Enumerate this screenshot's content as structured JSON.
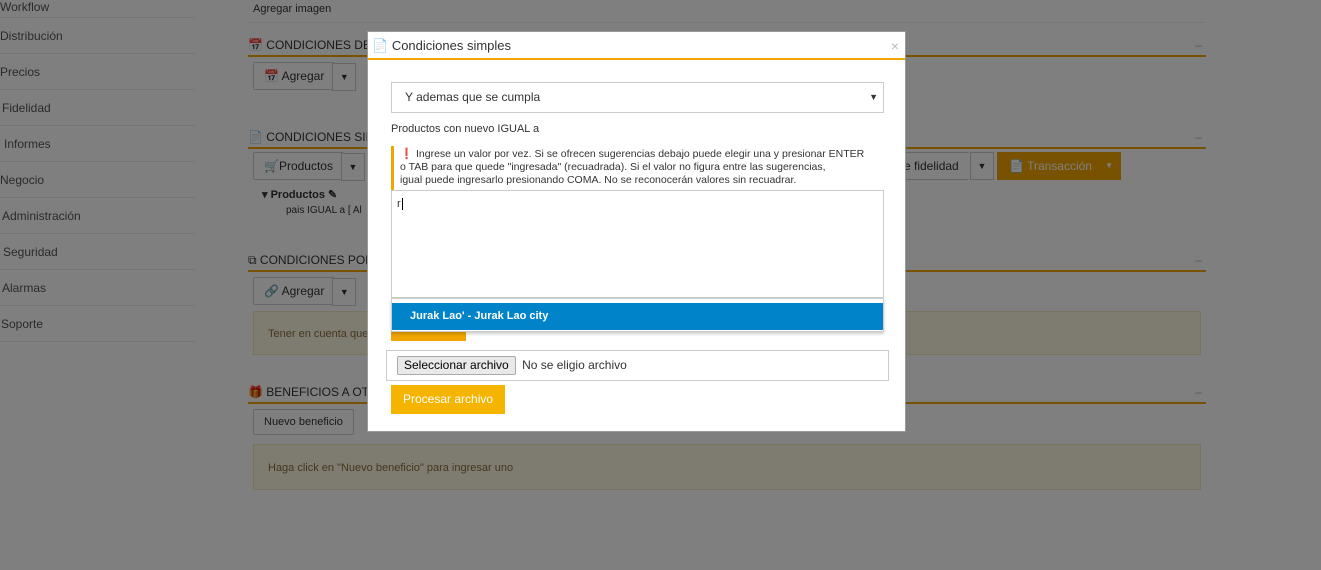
{
  "sidebar": {
    "items": [
      {
        "label": "Workflow"
      },
      {
        "label": "Distribución"
      },
      {
        "label": "Precios"
      },
      {
        "label": "Fidelidad"
      },
      {
        "label": "Informes"
      },
      {
        "label": "Negocio"
      },
      {
        "label": "Administración"
      },
      {
        "label": "Seguridad"
      },
      {
        "label": "Alarmas"
      },
      {
        "label": "Soporte"
      }
    ]
  },
  "main": {
    "add_image_label": "Agregar imagen",
    "section1": {
      "title": "CONDICIONES DE F",
      "add_button": "Agregar"
    },
    "section2": {
      "title": "CONDICIONES SIM",
      "products_button": "Productos",
      "fidelidad_button": "e fidelidad",
      "transaccion_button": "Transacción",
      "products_node": "Productos",
      "products_condition": "pais IGUAL a [ Al"
    },
    "section3": {
      "title": "CONDICIONES POR",
      "add_button": "Agregar",
      "note": "Tener en cuenta que"
    },
    "section4": {
      "title": "BENEFICIOS A OTO",
      "new_button": "Nuevo beneficio",
      "note": "Haga click en \"Nuevo beneficio\" para ingresar uno"
    },
    "collapse_symbol": "–"
  },
  "modal": {
    "title": "Condiciones simples",
    "close_symbol": "×",
    "select_value": "Y ademas que se cumpla",
    "field_label": "Productos con nuevo IGUAL a",
    "help_line1": "Ingrese un valor por vez. Si se ofrecen sugerencias debajo puede elegir una y presionar ENTER",
    "help_line2": "o TAB para que quede \"ingresada\" (recuadrada). Si el valor no figura entre las sugerencias,",
    "help_line3": "igual puede ingresarlo presionando COMA. No se reconocerán valores sin recuadrar.",
    "input_value": "r",
    "suggestion": "Jurak Lao' - Jurak Lao city",
    "file_button": "Seleccionar archivo",
    "file_status": "No se eligio archivo",
    "process_button": "Procesar archivo"
  },
  "colors": {
    "accent": "#f0a500",
    "highlight": "#0083c8"
  }
}
